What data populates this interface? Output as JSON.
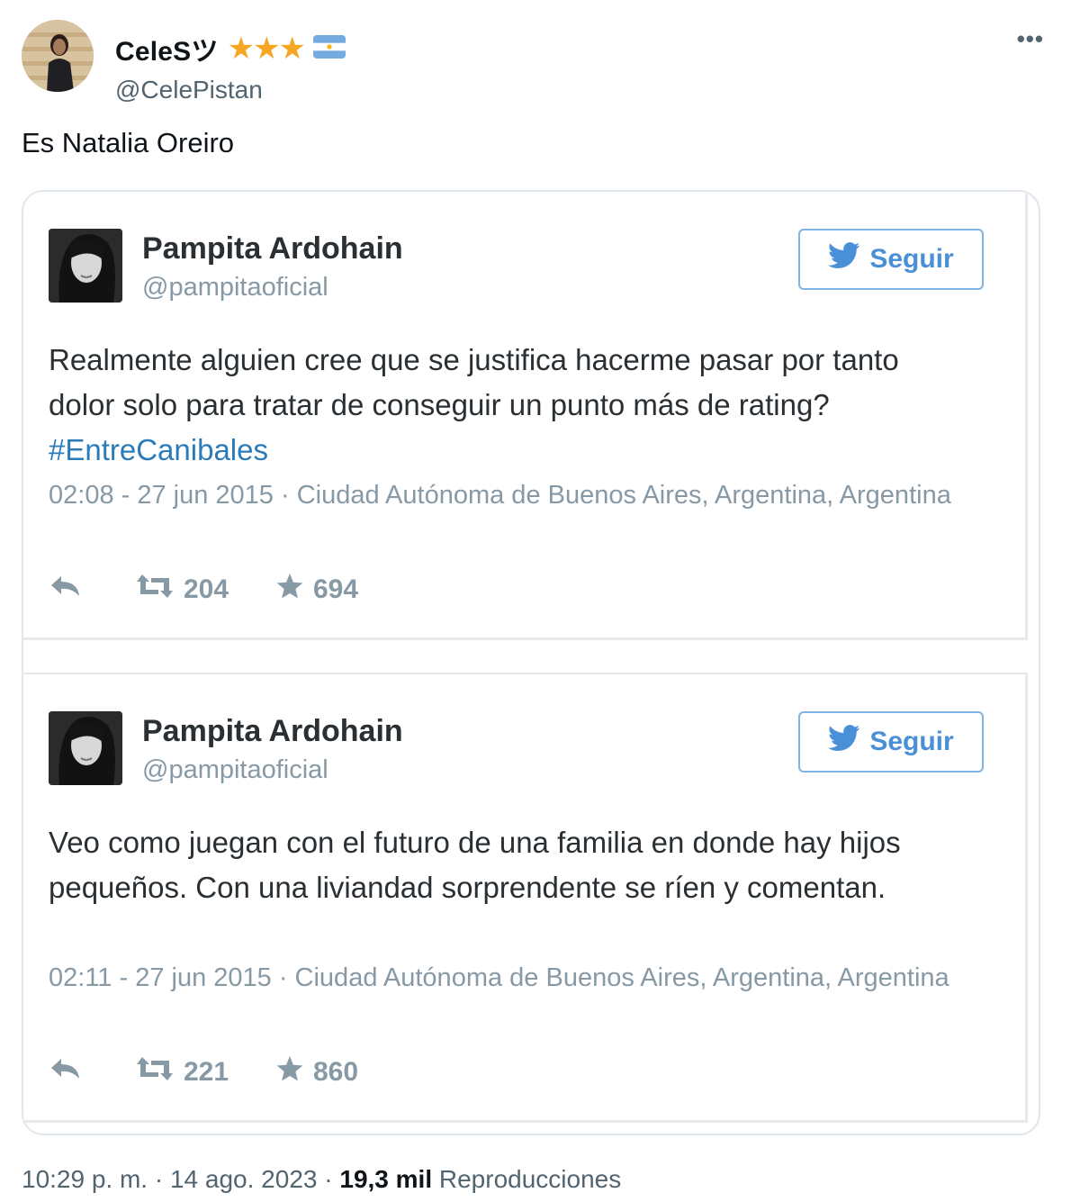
{
  "author": {
    "display_name": "CeleSツ",
    "stars": "★★★",
    "handle": "@CelePistan",
    "more": "•••"
  },
  "tweet": {
    "text": "Es Natalia Oreiro"
  },
  "embedded_tweets": [
    {
      "name": "Pampita Ardohain",
      "handle": "@pampitaoficial",
      "follow_label": "Seguir",
      "text": "Realmente alguien cree que se justifica hacerme pasar por tanto dolor solo para tratar de conseguir un punto más de rating?",
      "hashtag": "#EntreCanibales",
      "meta": "02:08 - 27 jun 2015 · Ciudad Autónoma de Buenos Aires, Argentina, Argentina",
      "retweets": "204",
      "favorites": "694"
    },
    {
      "name": "Pampita Ardohain",
      "handle": "@pampitaoficial",
      "follow_label": "Seguir",
      "text": "Veo como juegan con el futuro de una familia en donde hay hijos pequeños. Con una liviandad sorprendente se ríen y comentan.",
      "meta": "02:11 - 27 jun 2015 · Ciudad Autónoma de Buenos Aires, Argentina, Argentina",
      "retweets": "221",
      "favorites": "860"
    }
  ],
  "footer": {
    "time": "10:29 p. m.",
    "separator": "·",
    "date": "14 ago. 2023",
    "views_count": "19,3 mil",
    "views_label": "Reproducciones"
  },
  "colors": {
    "star_gold": "#f5a623",
    "twitter_blue": "#4a90d8",
    "hashtag_blue": "#2b7bb9",
    "muted_gray": "#8899a6"
  }
}
